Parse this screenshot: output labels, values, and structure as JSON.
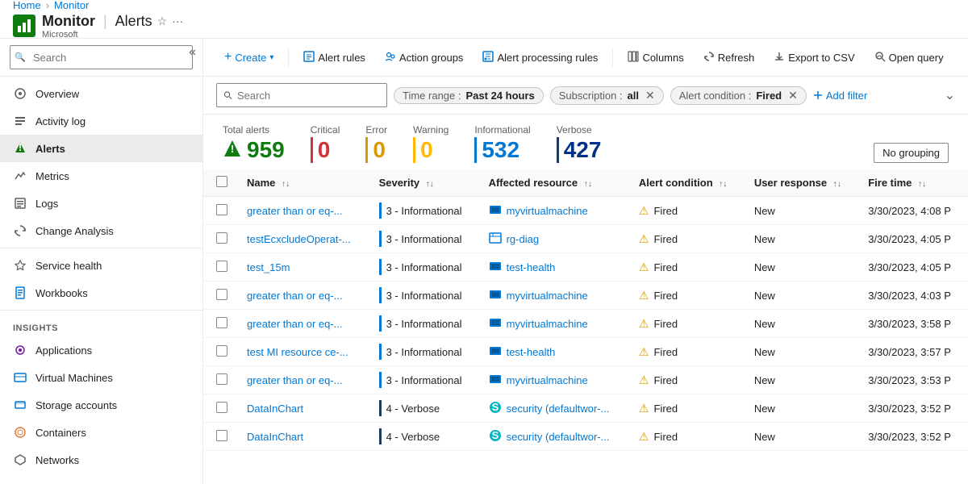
{
  "breadcrumb": {
    "home": "Home",
    "monitor": "Monitor"
  },
  "app": {
    "icon": "M",
    "name": "Monitor",
    "subtitle": "Alerts",
    "publisher": "Microsoft"
  },
  "sidebar": {
    "search_placeholder": "Search",
    "nav_items": [
      {
        "id": "overview",
        "label": "Overview",
        "icon": "⊙"
      },
      {
        "id": "activity-log",
        "label": "Activity log",
        "icon": "≡"
      },
      {
        "id": "alerts",
        "label": "Alerts",
        "icon": "🔔",
        "active": true
      },
      {
        "id": "metrics",
        "label": "Metrics",
        "icon": "📈"
      },
      {
        "id": "logs",
        "label": "Logs",
        "icon": "📋"
      },
      {
        "id": "change-analysis",
        "label": "Change Analysis",
        "icon": "⟲"
      }
    ],
    "section_health": "Service health",
    "nav_health": [
      {
        "id": "service-health",
        "label": "Service health",
        "icon": "♥"
      },
      {
        "id": "workbooks",
        "label": "Workbooks",
        "icon": "📔"
      }
    ],
    "section_insights": "Insights",
    "nav_insights": [
      {
        "id": "applications",
        "label": "Applications",
        "icon": "◈"
      },
      {
        "id": "virtual-machines",
        "label": "Virtual Machines",
        "icon": "▣"
      },
      {
        "id": "storage-accounts",
        "label": "Storage accounts",
        "icon": "≡"
      },
      {
        "id": "containers",
        "label": "Containers",
        "icon": "◉"
      },
      {
        "id": "networks",
        "label": "Networks",
        "icon": "⬡"
      }
    ]
  },
  "toolbar": {
    "create_label": "Create",
    "alert_rules_label": "Alert rules",
    "action_groups_label": "Action groups",
    "alert_processing_rules_label": "Alert processing rules",
    "columns_label": "Columns",
    "refresh_label": "Refresh",
    "export_csv_label": "Export to CSV",
    "open_query_label": "Open query"
  },
  "filters": {
    "search_placeholder": "Search",
    "time_range_label": "Time range :",
    "time_range_value": "Past 24 hours",
    "subscription_label": "Subscription :",
    "subscription_value": "all",
    "alert_condition_label": "Alert condition :",
    "alert_condition_value": "Fired",
    "add_filter_label": "Add filter"
  },
  "stats": {
    "total_alerts_label": "Total alerts",
    "total_alerts_value": "959",
    "critical_label": "Critical",
    "critical_value": "0",
    "error_label": "Error",
    "error_value": "0",
    "warning_label": "Warning",
    "warning_value": "0",
    "informational_label": "Informational",
    "informational_value": "532",
    "verbose_label": "Verbose",
    "verbose_value": "427",
    "no_grouping_label": "No grouping"
  },
  "table": {
    "columns": [
      {
        "id": "name",
        "label": "Name"
      },
      {
        "id": "severity",
        "label": "Severity"
      },
      {
        "id": "resource",
        "label": "Affected resource"
      },
      {
        "id": "condition",
        "label": "Alert condition"
      },
      {
        "id": "response",
        "label": "User response"
      },
      {
        "id": "fire_time",
        "label": "Fire time"
      }
    ],
    "rows": [
      {
        "name": "greater than or eq-...",
        "severity": "3 - Informational",
        "severity_color": "blue",
        "resource": "myvirtualmachine",
        "resource_type": "vm",
        "condition": "Fired",
        "response": "New",
        "fire_time": "3/30/2023, 4:08 P"
      },
      {
        "name": "testEcxcludeOperat-...",
        "severity": "3 - Informational",
        "severity_color": "blue",
        "resource": "rg-diag",
        "resource_type": "rg",
        "condition": "Fired",
        "response": "New",
        "fire_time": "3/30/2023, 4:05 P"
      },
      {
        "name": "test_15m",
        "severity": "3 - Informational",
        "severity_color": "blue",
        "resource": "test-health",
        "resource_type": "vm",
        "condition": "Fired",
        "response": "New",
        "fire_time": "3/30/2023, 4:05 P"
      },
      {
        "name": "greater than or eq-...",
        "severity": "3 - Informational",
        "severity_color": "blue",
        "resource": "myvirtualmachine",
        "resource_type": "vm",
        "condition": "Fired",
        "response": "New",
        "fire_time": "3/30/2023, 4:03 P"
      },
      {
        "name": "greater than or eq-...",
        "severity": "3 - Informational",
        "severity_color": "blue",
        "resource": "myvirtualmachine",
        "resource_type": "vm",
        "condition": "Fired",
        "response": "New",
        "fire_time": "3/30/2023, 3:58 P"
      },
      {
        "name": "test MI resource ce-...",
        "severity": "3 - Informational",
        "severity_color": "blue",
        "resource": "test-health",
        "resource_type": "vm",
        "condition": "Fired",
        "response": "New",
        "fire_time": "3/30/2023, 3:57 P"
      },
      {
        "name": "greater than or eq-...",
        "severity": "3 - Informational",
        "severity_color": "blue",
        "resource": "myvirtualmachine",
        "resource_type": "vm",
        "condition": "Fired",
        "response": "New",
        "fire_time": "3/30/2023, 3:53 P"
      },
      {
        "name": "DataInChart",
        "severity": "4 - Verbose",
        "severity_color": "darkblue",
        "resource": "security (defaultwor-...",
        "resource_type": "sec",
        "condition": "Fired",
        "response": "New",
        "fire_time": "3/30/2023, 3:52 P"
      },
      {
        "name": "DataInChart",
        "severity": "4 - Verbose",
        "severity_color": "darkblue",
        "resource": "security (defaultwor-...",
        "resource_type": "sec",
        "condition": "Fired",
        "response": "New",
        "fire_time": "3/30/2023, 3:52 P"
      }
    ]
  }
}
